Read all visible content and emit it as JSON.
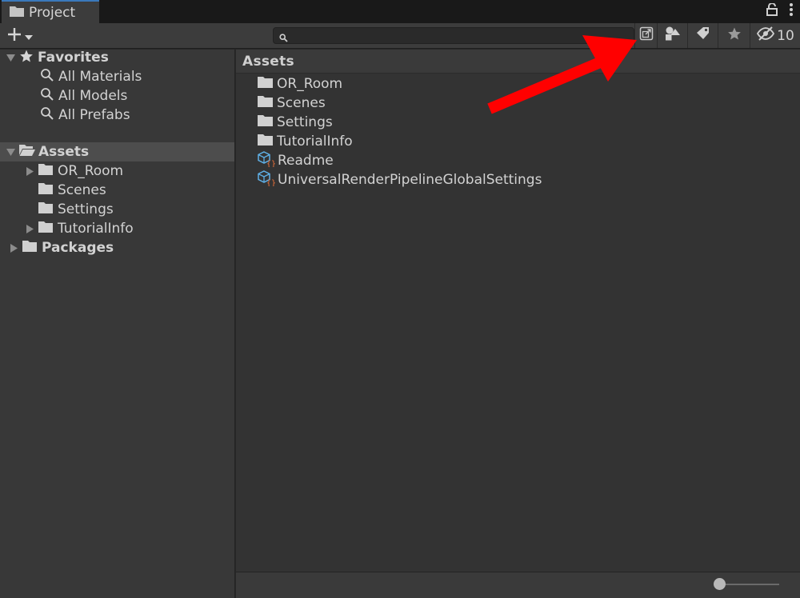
{
  "window": {
    "tab_title": "Project",
    "hidden_packages_count": "10"
  },
  "toolbar": {
    "search_placeholder": "",
    "create_icon": "plus-icon",
    "search_window_icon": "open-in-new-window-icon",
    "type_filter_icon": "shapes-icon",
    "label_filter_icon": "tag-icon",
    "favorite_icon": "star-icon",
    "hidden_packages_icon": "eye-slash-icon"
  },
  "tree": {
    "favorites": {
      "label": "Favorites",
      "items": [
        {
          "label": "All Materials"
        },
        {
          "label": "All Models"
        },
        {
          "label": "All Prefabs"
        }
      ]
    },
    "assets": {
      "label": "Assets",
      "children": [
        {
          "label": "OR_Room",
          "expandable": true
        },
        {
          "label": "Scenes",
          "expandable": false
        },
        {
          "label": "Settings",
          "expandable": false
        },
        {
          "label": "TutorialInfo",
          "expandable": true
        }
      ]
    },
    "packages": {
      "label": "Packages"
    }
  },
  "main": {
    "breadcrumb": "Assets",
    "items": [
      {
        "label": "OR_Room",
        "kind": "folder"
      },
      {
        "label": "Scenes",
        "kind": "folder"
      },
      {
        "label": "Settings",
        "kind": "folder"
      },
      {
        "label": "TutorialInfo",
        "kind": "folder"
      },
      {
        "label": "Readme",
        "kind": "scriptable-object"
      },
      {
        "label": "UniversalRenderPipelineGlobalSettings",
        "kind": "scriptable-object"
      }
    ]
  },
  "colors": {
    "accent_tab": "#3a79bb",
    "annotation_arrow": "#ff0000",
    "selected_row": "#4d4d4d"
  }
}
